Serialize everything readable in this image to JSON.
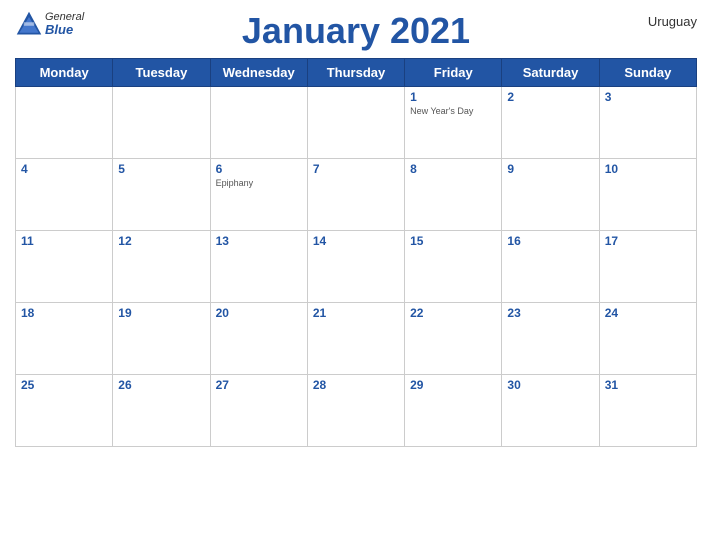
{
  "header": {
    "title": "January 2021",
    "country": "Uruguay",
    "logo_general": "General",
    "logo_blue": "Blue"
  },
  "weekdays": [
    "Monday",
    "Tuesday",
    "Wednesday",
    "Thursday",
    "Friday",
    "Saturday",
    "Sunday"
  ],
  "weeks": [
    [
      {
        "day": "",
        "empty": true
      },
      {
        "day": "",
        "empty": true
      },
      {
        "day": "",
        "empty": true
      },
      {
        "day": "",
        "empty": true
      },
      {
        "day": "1",
        "event": "New Year's Day"
      },
      {
        "day": "2",
        "event": ""
      },
      {
        "day": "3",
        "event": ""
      }
    ],
    [
      {
        "day": "4",
        "event": ""
      },
      {
        "day": "5",
        "event": ""
      },
      {
        "day": "6",
        "event": "Epiphany"
      },
      {
        "day": "7",
        "event": ""
      },
      {
        "day": "8",
        "event": ""
      },
      {
        "day": "9",
        "event": ""
      },
      {
        "day": "10",
        "event": ""
      }
    ],
    [
      {
        "day": "11",
        "event": ""
      },
      {
        "day": "12",
        "event": ""
      },
      {
        "day": "13",
        "event": ""
      },
      {
        "day": "14",
        "event": ""
      },
      {
        "day": "15",
        "event": ""
      },
      {
        "day": "16",
        "event": ""
      },
      {
        "day": "17",
        "event": ""
      }
    ],
    [
      {
        "day": "18",
        "event": ""
      },
      {
        "day": "19",
        "event": ""
      },
      {
        "day": "20",
        "event": ""
      },
      {
        "day": "21",
        "event": ""
      },
      {
        "day": "22",
        "event": ""
      },
      {
        "day": "23",
        "event": ""
      },
      {
        "day": "24",
        "event": ""
      }
    ],
    [
      {
        "day": "25",
        "event": ""
      },
      {
        "day": "26",
        "event": ""
      },
      {
        "day": "27",
        "event": ""
      },
      {
        "day": "28",
        "event": ""
      },
      {
        "day": "29",
        "event": ""
      },
      {
        "day": "30",
        "event": ""
      },
      {
        "day": "31",
        "event": ""
      }
    ]
  ]
}
